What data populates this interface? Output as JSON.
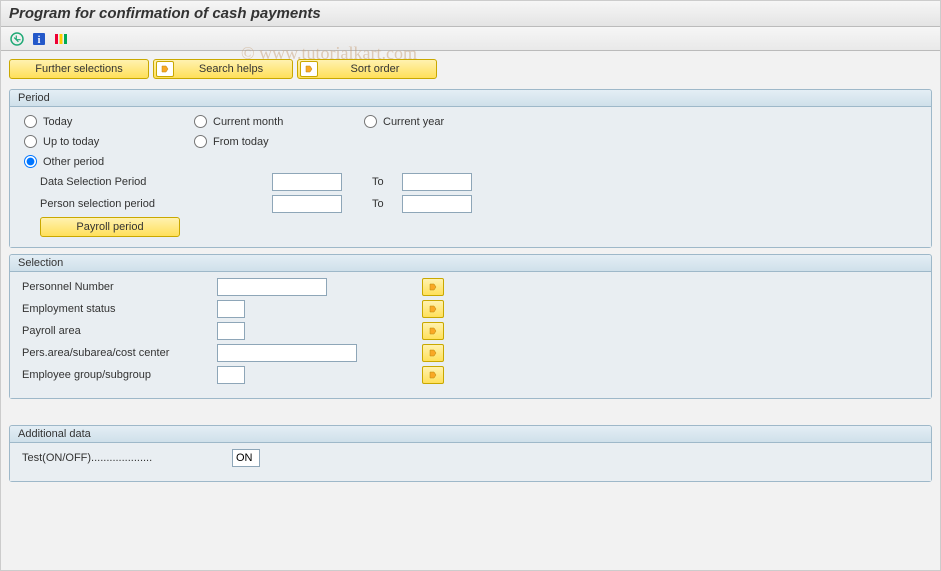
{
  "title": "Program for confirmation of cash payments",
  "watermark": "© www.tutorialkart.com",
  "buttons": {
    "further_selections": "Further selections",
    "search_helps": "Search helps",
    "sort_order": "Sort order"
  },
  "period": {
    "header": "Period",
    "radios": {
      "today": "Today",
      "current_month": "Current month",
      "current_year": "Current year",
      "up_to_today": "Up to today",
      "from_today": "From today",
      "other_period": "Other period"
    },
    "selected": "other_period",
    "data_selection_label": "Data Selection Period",
    "person_selection_label": "Person selection period",
    "to_label": "To",
    "data_from": "",
    "data_to": "",
    "person_from": "",
    "person_to": "",
    "payroll_button": "Payroll period"
  },
  "selection": {
    "header": "Selection",
    "rows": [
      {
        "label": "Personnel Number",
        "value": "",
        "width": "w100"
      },
      {
        "label": "Employment status",
        "value": "",
        "width": "w40"
      },
      {
        "label": "Payroll area",
        "value": "",
        "width": "w40"
      },
      {
        "label": "Pers.area/subarea/cost center",
        "value": "",
        "width": "w130"
      },
      {
        "label": "Employee group/subgroup",
        "value": "",
        "width": "w40"
      }
    ]
  },
  "additional": {
    "header": "Additional data",
    "test_label": "Test(ON/OFF)....................",
    "test_value": "ON"
  }
}
